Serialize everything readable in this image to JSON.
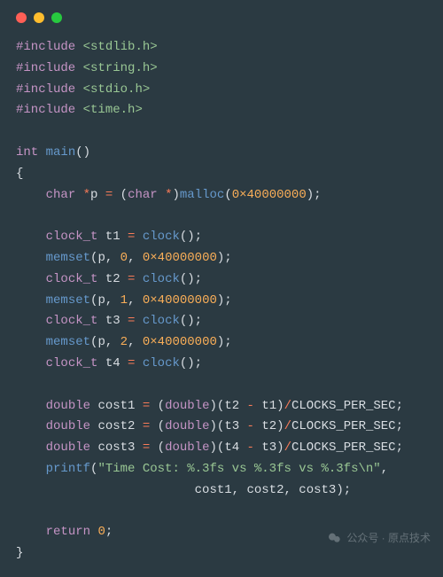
{
  "includes": [
    "stdlib.h",
    "string.h",
    "stdio.h",
    "time.h"
  ],
  "decl": {
    "ret_type": "int",
    "name": "main",
    "open_brace": "{",
    "close_brace": "}"
  },
  "malloc": {
    "type": "char",
    "ptr": "*",
    "var": "p",
    "eq": "=",
    "cast_open": "(",
    "cast_type": "char",
    "cast_star": "*",
    "cast_close": ")",
    "func": "malloc",
    "arg": "0×40000000"
  },
  "clocks": {
    "type": "clock_t",
    "func": "clock",
    "t1": "t1",
    "t2": "t2",
    "t3": "t3",
    "t4": "t4",
    "eq": "="
  },
  "memset": {
    "func": "memset",
    "p": "p",
    "size": "0×40000000",
    "v0": "0",
    "v1": "1",
    "v2": "2"
  },
  "cost": {
    "type": "double",
    "c1": "cost1",
    "c2": "cost2",
    "c3": "cost3",
    "eq": "=",
    "cast": "double",
    "div": "/",
    "minus": "-",
    "const": "CLOCKS_PER_SEC"
  },
  "printf": {
    "func": "printf",
    "fmt": "\"Time Cost: %.3fs vs %.3fs vs %.3fs\\n\"",
    "a1": "cost1",
    "a2": "cost2",
    "a3": "cost3"
  },
  "ret": {
    "kw": "return",
    "val": "0"
  },
  "watermark": {
    "label": "公众号 · 原点技术"
  }
}
